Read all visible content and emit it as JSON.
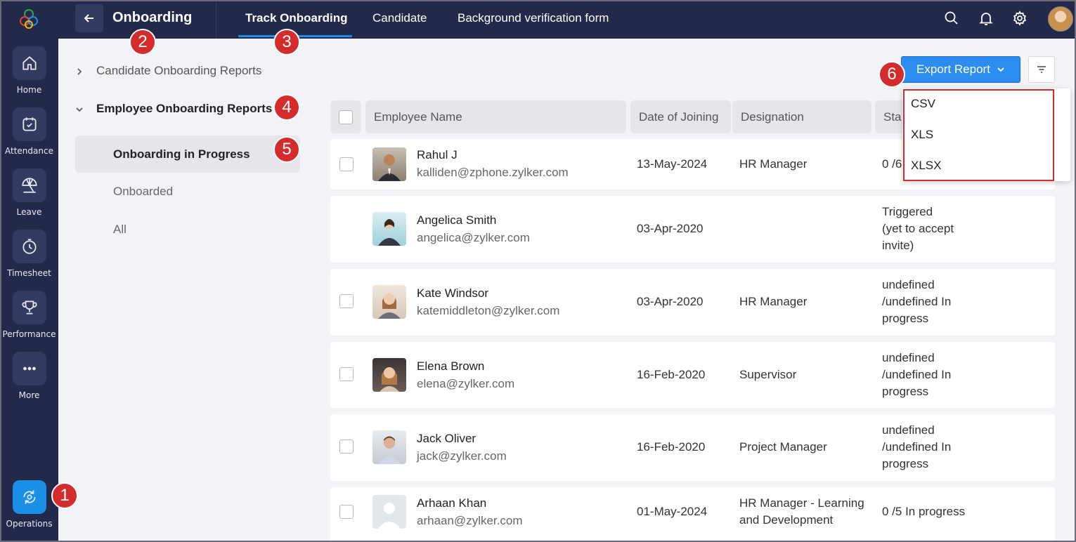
{
  "rail": {
    "items": [
      {
        "label": "Home",
        "icon": "home-icon"
      },
      {
        "label": "Attendance",
        "icon": "calendar-check-icon"
      },
      {
        "label": "Leave",
        "icon": "beach-umbrella-icon"
      },
      {
        "label": "Timesheet",
        "icon": "timer-icon"
      },
      {
        "label": "Performance",
        "icon": "trophy-icon"
      },
      {
        "label": "More",
        "icon": "more-dots-icon"
      },
      {
        "label": "Operations",
        "icon": "operations-icon"
      }
    ]
  },
  "header": {
    "title": "Onboarding",
    "tabs": [
      "Track Onboarding",
      "Candidate",
      "Background verification form"
    ],
    "active_tab": "Track Onboarding"
  },
  "sidebar": {
    "group1": "Candidate Onboarding Reports",
    "group2": "Employee Onboarding Reports",
    "items": [
      "Onboarding in Progress",
      "Onboarded",
      "All"
    ],
    "selected": "Onboarding in Progress"
  },
  "toolbar": {
    "export_label": "Export Report",
    "export_options": [
      "CSV",
      "XLS",
      "XLSX"
    ]
  },
  "table": {
    "columns": [
      "Employee Name",
      "Date of Joining",
      "Designation",
      "Sta"
    ],
    "rows": [
      {
        "name": "Rahul J",
        "email": "kalliden@zphone.zylker.com",
        "date": "13-May-2024",
        "designation": "HR Manager",
        "status": "0 /6"
      },
      {
        "name": "Angelica Smith",
        "email": "angelica@zylker.com",
        "date": "03-Apr-2020",
        "designation": "",
        "status": "Triggered\n(yet to accept\ninvite)"
      },
      {
        "name": "Kate Windsor",
        "email": "katemiddleton@zylker.com",
        "date": "03-Apr-2020",
        "designation": "HR Manager",
        "status": "undefined\n/undefined In\nprogress"
      },
      {
        "name": "Elena Brown",
        "email": "elena@zylker.com",
        "date": "16-Feb-2020",
        "designation": "Supervisor",
        "status": "undefined\n/undefined In\nprogress"
      },
      {
        "name": "Jack Oliver",
        "email": "jack@zylker.com",
        "date": "16-Feb-2020",
        "designation": "Project Manager",
        "status": "undefined\n/undefined In\nprogress"
      },
      {
        "name": "Arhaan Khan",
        "email": "arhaan@zylker.com",
        "date": "01-May-2024",
        "designation": "HR Manager - Learning and Development",
        "status": "0 /5 In progress"
      }
    ]
  },
  "markers": [
    "1",
    "2",
    "3",
    "4",
    "5",
    "6"
  ],
  "colors": {
    "nav_bg": "#23294a",
    "accent": "#2d8cf0",
    "marker": "#d42c2c"
  }
}
